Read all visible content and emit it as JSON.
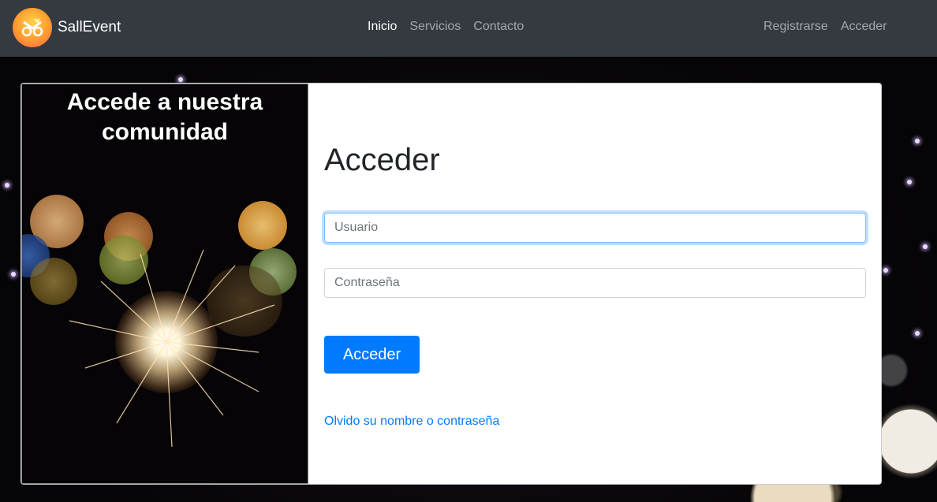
{
  "navbar": {
    "brand": "SallEvent",
    "center_links": [
      {
        "label": "Inicio",
        "active": true
      },
      {
        "label": "Servicios",
        "active": false
      },
      {
        "label": "Contacto",
        "active": false
      }
    ],
    "right_links": [
      {
        "label": "Registrarse"
      },
      {
        "label": "Acceder"
      }
    ]
  },
  "left_panel": {
    "title_line1": "Accede a nuestra",
    "title_line2": "comunidad"
  },
  "form": {
    "heading": "Acceder",
    "username_placeholder": "Usuario",
    "password_placeholder": "Contraseña",
    "submit_label": "Acceder",
    "forgot_link": "Olvido su nombre o contraseña"
  },
  "colors": {
    "navbar_bg": "#343a40",
    "primary": "#007bff",
    "focus_border": "#80bdff"
  }
}
